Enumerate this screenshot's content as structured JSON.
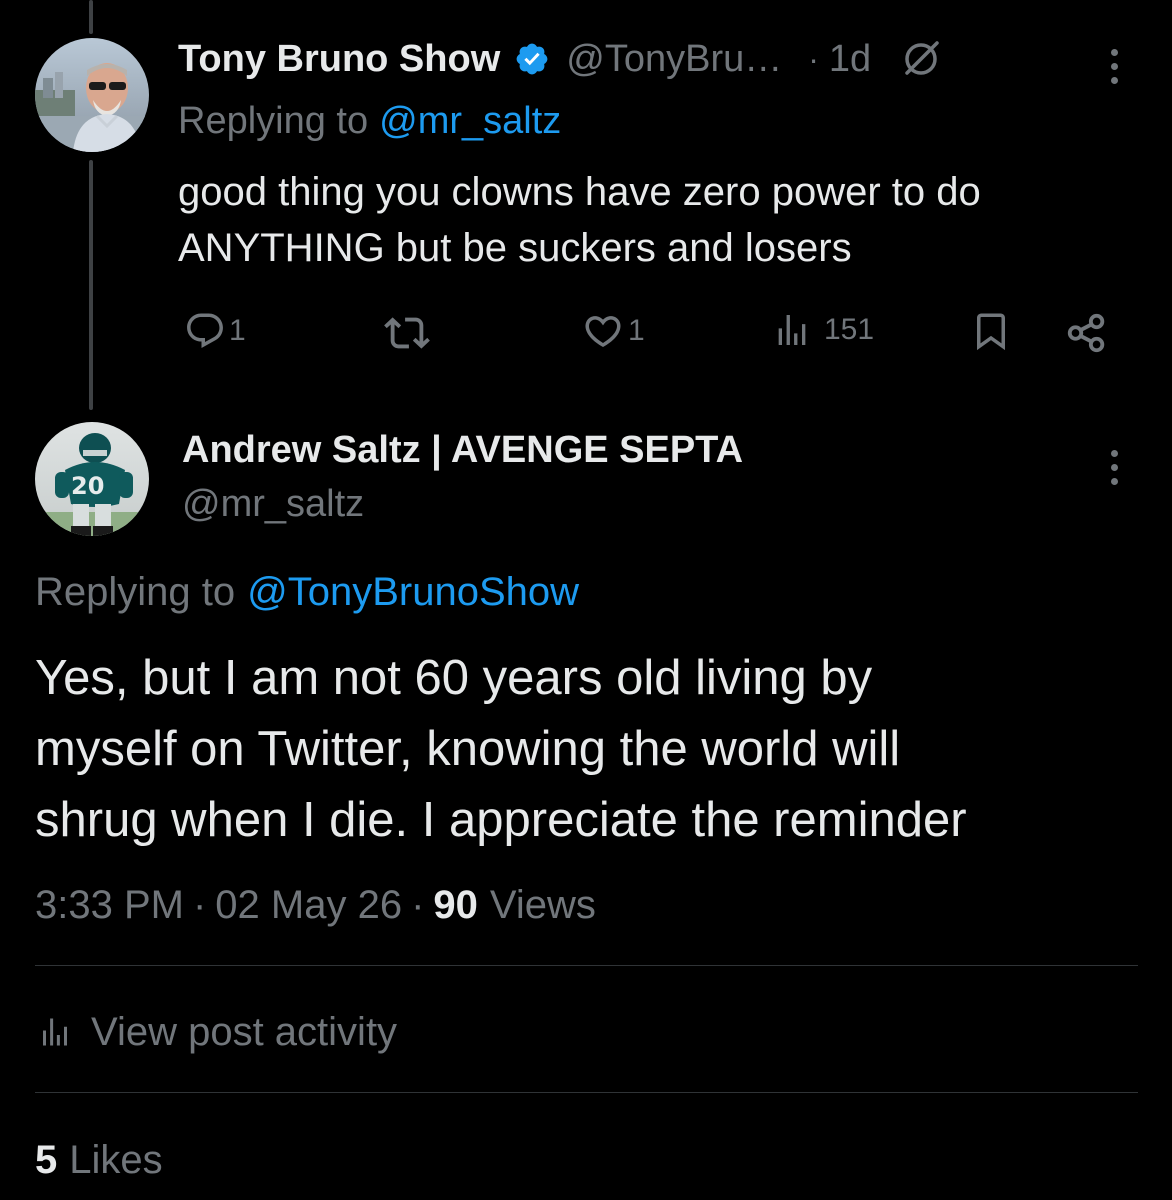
{
  "parent_post": {
    "display_name": "Tony Bruno Show",
    "verified_icon": "verified-badge-icon",
    "handle": "@TonyBru…",
    "separator": "·",
    "time_ago": "1d",
    "replying_prefix": "Replying to",
    "replying_to": "@mr_saltz",
    "text_line1": "good thing you clowns have zero power to do",
    "text_line2": "ANYTHING but be suckers and losers",
    "actions": {
      "reply_count": "1",
      "repost_count": "",
      "like_count": "1",
      "view_count": "151"
    }
  },
  "main_post": {
    "display_name": "Andrew Saltz | AVENGE SEPTA",
    "handle": "@mr_saltz",
    "replying_prefix": "Replying to",
    "replying_to": "@TonyBrunoShow",
    "text_line1": "Yes, but I am not 60 years old living by",
    "text_line2": "myself on Twitter, knowing the world will",
    "text_line3": "shrug when I die. I appreciate the reminder",
    "time": "3:33 PM",
    "dot1": "·",
    "date": "02 May 26",
    "dot2": "·",
    "views_count": "90",
    "views_label": "Views",
    "view_activity_label": "View post activity",
    "likes_count": "5",
    "likes_label": "Likes"
  },
  "colors": {
    "background": "#000000",
    "text": "#e7e9ea",
    "muted": "#71767b",
    "link": "#1d9bf0",
    "divider": "#2f3336",
    "thread_line": "#3e4144"
  }
}
